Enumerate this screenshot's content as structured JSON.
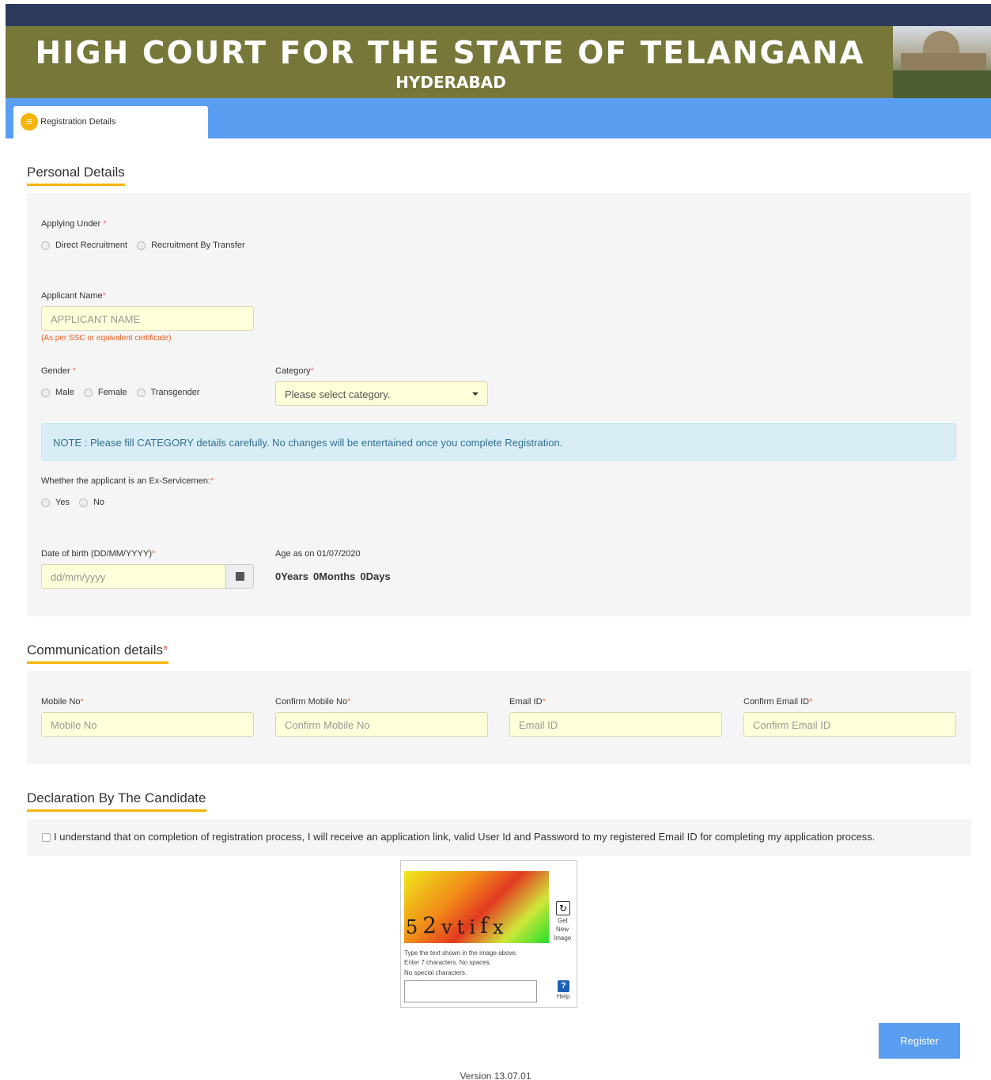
{
  "header": {
    "title": "HIGH COURT FOR THE STATE OF TELANGANA",
    "subtitle": "HYDERABAD"
  },
  "nav": {
    "tab_label": "Registration Details",
    "tab_icon": "form-icon"
  },
  "personal": {
    "title": "Personal Details",
    "applying_under": {
      "label": "Applying Under",
      "options": [
        "Direct Recruitment",
        "Recruitment By Transfer"
      ]
    },
    "applicant_name": {
      "label": "Applicant Name",
      "placeholder": "APPLICANT NAME",
      "hint": "(As per SSC or equivalent certificate)"
    },
    "gender": {
      "label": "Gender",
      "options": [
        "Male",
        "Female",
        "Transgender"
      ]
    },
    "category": {
      "label": "Category",
      "selected": "Please select category."
    },
    "note": "NOTE : Please fill CATEGORY details carefully. No changes will be entertained once you complete Registration.",
    "ex_servicemen": {
      "label": "Whether the applicant is an Ex-Servicemen:",
      "options": [
        "Yes",
        "No"
      ]
    },
    "dob": {
      "label": "Date of birth (DD/MM/YYYY)",
      "placeholder": "dd/mm/yyyy"
    },
    "age": {
      "label": "Age as on 01/07/2020",
      "years": "0Years",
      "months": "0Months",
      "days": "0Days"
    }
  },
  "communication": {
    "title": "Communication details",
    "mobile": {
      "label": "Mobile No",
      "placeholder": "Mobile No"
    },
    "confirm_mobile": {
      "label": "Confirm Mobile No",
      "placeholder": "Confirm Mobile No"
    },
    "email": {
      "label": "Email ID",
      "placeholder": "Email ID"
    },
    "confirm_email": {
      "label": "Confirm Email ID",
      "placeholder": "Confirm Email ID"
    }
  },
  "declaration": {
    "title": "Declaration By The Candidate",
    "text": "I understand that on completion of registration process, I will receive an application link, valid User Id and Password to my registered Email ID for completing my application process."
  },
  "captcha": {
    "chars": [
      "5",
      "2",
      "v",
      "t",
      "i",
      "f",
      "x"
    ],
    "refresh_label_1": "Get",
    "refresh_label_2": "New",
    "refresh_label_3": "Image",
    "instruction_1": "Type the text shown in the image above.",
    "instruction_2": "Enter 7 characters. No spaces.",
    "instruction_3": "No special characters.",
    "help_label": "Help"
  },
  "actions": {
    "register_label": "Register"
  },
  "footer": {
    "version": "Version 13.07.01"
  },
  "colors": {
    "header_bar": "#2c3a5c",
    "banner": "#77773a",
    "nav": "#5a9ef2",
    "accent": "#f5b301",
    "required": "#f26a4f",
    "input_bg": "#ffffd9"
  }
}
